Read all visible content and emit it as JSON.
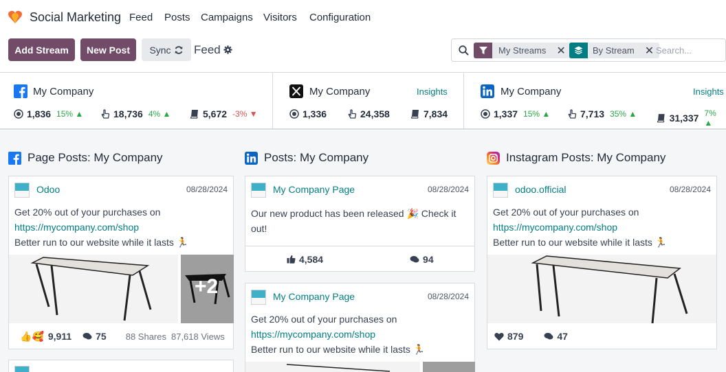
{
  "app": {
    "name": "Social Marketing"
  },
  "nav": {
    "feed": "Feed",
    "posts": "Posts",
    "campaigns": "Campaigns",
    "visitors": "Visitors",
    "configuration": "Configuration"
  },
  "toolbar": {
    "add_stream": "Add Stream",
    "new_post": "New Post",
    "sync": "Sync",
    "title": "Feed"
  },
  "search": {
    "facet1": "My Streams",
    "facet2": "By Stream",
    "placeholder": "Search..."
  },
  "accounts": [
    {
      "network": "facebook",
      "name": "My Company",
      "insights": "",
      "audience": "1,836",
      "audience_trend": "15%",
      "engagement": "18,736",
      "engagement_trend": "4%",
      "stories": "5,672",
      "stories_trend": "-3%"
    },
    {
      "network": "x",
      "name": "My Company",
      "insights": "Insights",
      "audience": "1,336",
      "engagement": "24,358",
      "stories": "7,834"
    },
    {
      "network": "linkedin",
      "name": "My Company",
      "insights": "Insights",
      "audience": "1,337",
      "audience_trend": "15%",
      "engagement": "7,713",
      "engagement_trend": "35%",
      "stories": "31,337",
      "stories_trend": "7%"
    }
  ],
  "columns": [
    {
      "title": "Page Posts: My Company",
      "network": "facebook"
    },
    {
      "title": "Posts: My Company",
      "network": "linkedin"
    },
    {
      "title": "Instagram Posts: My Company",
      "network": "instagram"
    }
  ],
  "posts": {
    "fb1": {
      "author": "Odoo",
      "date": "08/28/2024",
      "line1": "Get 20% out of your purchases on",
      "link": "https://mycompany.com/shop",
      "line3": "Better run to our website while it lasts 🏃",
      "more_images": "+2",
      "likes": "9,911",
      "comments": "75",
      "shares": "88 Shares",
      "views": "87,618 Views"
    },
    "li1": {
      "author": "My Company Page",
      "date": "08/28/2024",
      "line1": "Our new product has been released 🎉 Check it",
      "line2": "out!",
      "likes": "4,584",
      "comments": "94"
    },
    "li2": {
      "author": "My Company Page",
      "date": "08/28/2024",
      "line1": "Get 20% out of your purchases on",
      "link": "https://mycompany.com/shop",
      "line3": "Better run to our website while it lasts 🏃"
    },
    "ig1": {
      "author": "odoo.official",
      "date": "08/28/2024",
      "line1": "Get 20% out of your purchases on",
      "link": "https://mycompany.com/shop",
      "line3": "Better run to our website while it lasts 🏃",
      "likes": "879",
      "comments": "47"
    }
  },
  "colors": {
    "brand": "#714b67",
    "teal": "#017e84",
    "up": "#28a745",
    "down": "#d9534f"
  }
}
